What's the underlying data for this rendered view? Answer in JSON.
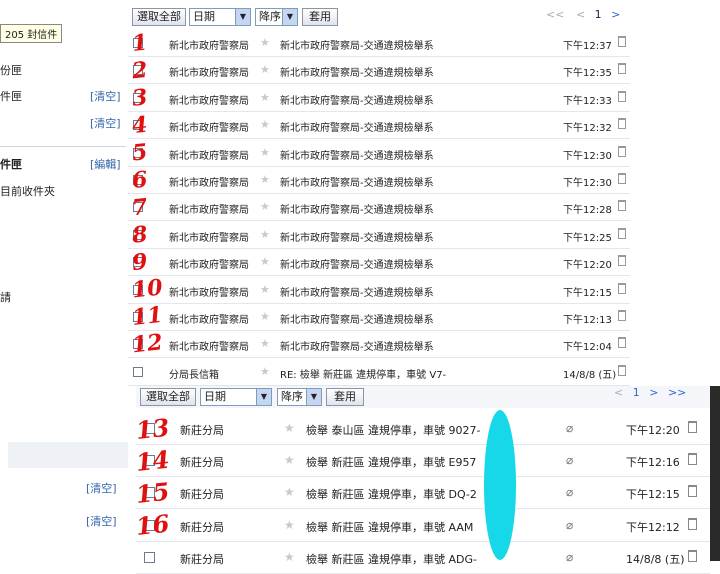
{
  "tooltip": "205 封信件",
  "top_nav": [
    {
      "label": "份匣",
      "bold": false
    },
    {
      "label": "件匣",
      "bold": false,
      "action": "[清空]"
    },
    {
      "label": "",
      "bold": false,
      "action": "[清空]"
    },
    {
      "label": "件匣",
      "bold": true,
      "action": "[編輯]"
    },
    {
      "label": "目前收件夾",
      "bold": false
    },
    {
      "label": "請",
      "bold": false
    }
  ],
  "toolbar": {
    "select_all": "選取全部",
    "sort_field": "日期",
    "sort_order": "降序",
    "apply": "套用",
    "pager_first": "<<",
    "pager_prev": "<",
    "page": "1",
    "pager_next": ">",
    "pager_last": ">>"
  },
  "top_rows": [
    {
      "from": "新北市政府警察局",
      "subject": "新北市政府警察局-交通違規檢舉系",
      "time": "下午12:37"
    },
    {
      "from": "新北市政府警察局",
      "subject": "新北市政府警察局-交通違規檢舉系",
      "time": "下午12:35"
    },
    {
      "from": "新北市政府警察局",
      "subject": "新北市政府警察局-交通違規檢舉系",
      "time": "下午12:33"
    },
    {
      "from": "新北市政府警察局",
      "subject": "新北市政府警察局-交通違規檢舉系",
      "time": "下午12:32"
    },
    {
      "from": "新北市政府警察局",
      "subject": "新北市政府警察局-交通違規檢舉系",
      "time": "下午12:30"
    },
    {
      "from": "新北市政府警察局",
      "subject": "新北市政府警察局-交通違規檢舉系",
      "time": "下午12:30"
    },
    {
      "from": "新北市政府警察局",
      "subject": "新北市政府警察局-交通違規檢舉系",
      "time": "下午12:28"
    },
    {
      "from": "新北市政府警察局",
      "subject": "新北市政府警察局-交通違規檢舉系",
      "time": "下午12:25"
    },
    {
      "from": "新北市政府警察局",
      "subject": "新北市政府警察局-交通違規檢舉系",
      "time": "下午12:20"
    },
    {
      "from": "新北市政府警察局",
      "subject": "新北市政府警察局-交通違規檢舉系",
      "time": "下午12:15"
    },
    {
      "from": "新北市政府警察局",
      "subject": "新北市政府警察局-交通違規檢舉系",
      "time": "下午12:13"
    },
    {
      "from": "新北市政府警察局",
      "subject": "新北市政府警察局-交通違規檢舉系",
      "time": "下午12:04"
    },
    {
      "from": "分局長信箱",
      "subject": "RE: 檢舉 新莊區 違規停車，車號 V7-",
      "time": "14/8/8 (五)"
    }
  ],
  "bottom_nav": [
    {
      "action": "[清空]"
    },
    {
      "action": "[清空]"
    }
  ],
  "bottom_rows": [
    {
      "from": "新莊分局",
      "subject": "檢舉 泰山區 違規停車，車號 9027-",
      "time": "下午12:20",
      "attachment": true
    },
    {
      "from": "新莊分局",
      "subject": "檢舉 新莊區 違規停車，車號 E957",
      "time": "下午12:16",
      "attachment": true
    },
    {
      "from": "新莊分局",
      "subject": "檢舉 新莊區 違規停車，車號 DQ-2",
      "time": "下午12:15",
      "attachment": true
    },
    {
      "from": "新莊分局",
      "subject": "檢舉 新莊區 違規停車，車號 AAM",
      "time": "下午12:12",
      "attachment": true
    },
    {
      "from": "新莊分局",
      "subject": "檢舉 新莊區 違規停車，車號 ADG-",
      "time": "14/8/8 (五)",
      "attachment": true
    }
  ],
  "handwritten_numbers": [
    "1",
    "2",
    "3",
    "4",
    "5",
    "6",
    "7",
    "8",
    "9",
    "10",
    "11",
    "12",
    "13",
    "14",
    "15",
    "16"
  ],
  "colors": {
    "annotation": "#e01010",
    "redaction": "#17d8e8",
    "link": "#3366aa"
  }
}
